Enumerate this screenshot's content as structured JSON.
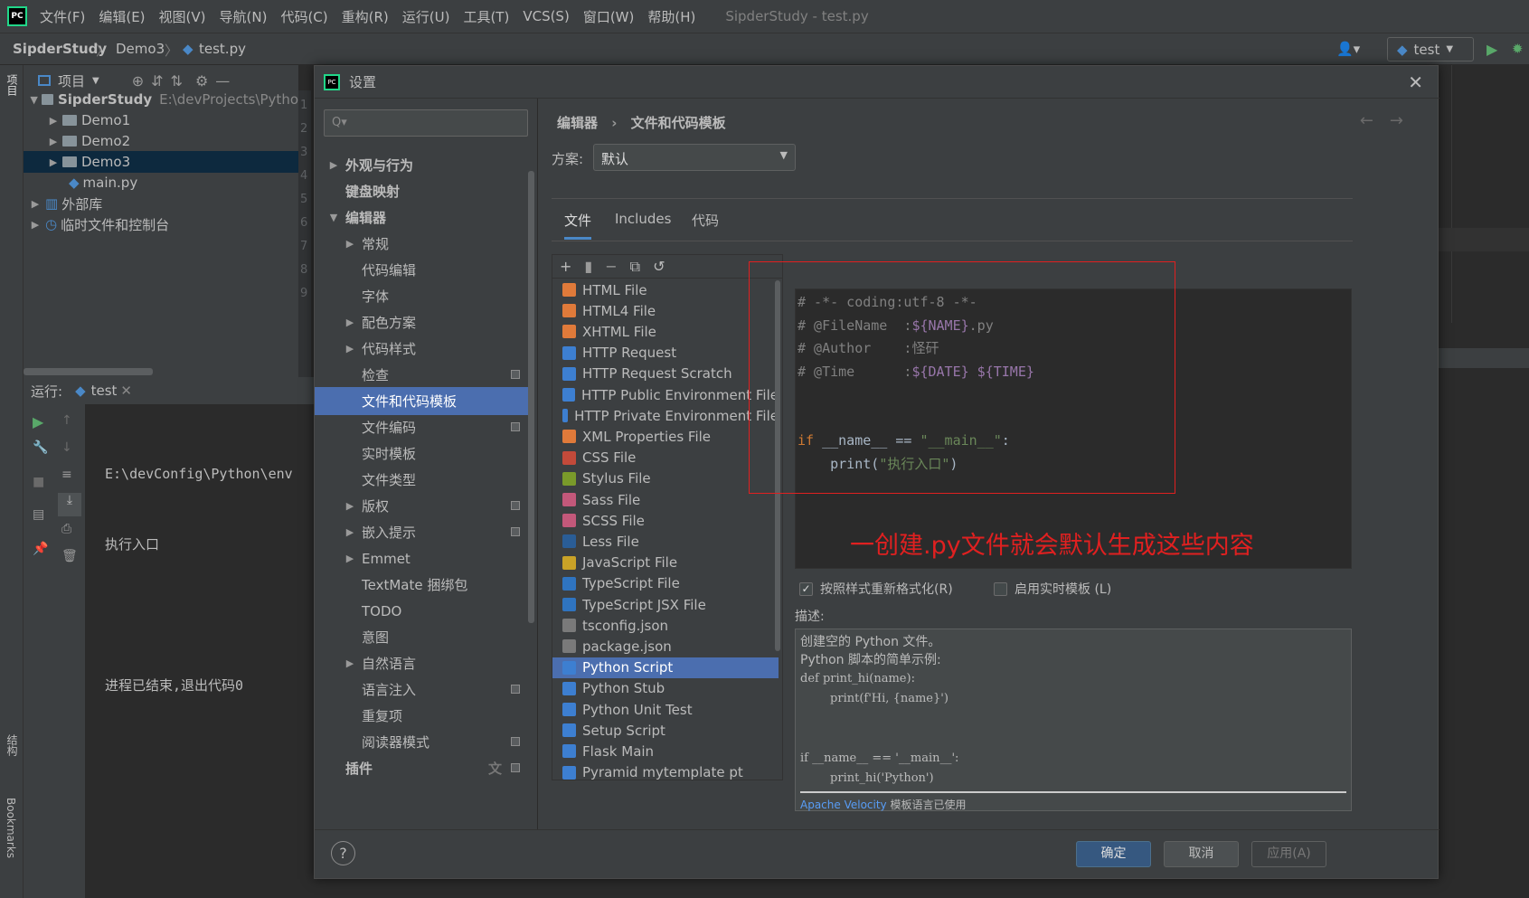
{
  "menubar": {
    "items": [
      "文件(F)",
      "编辑(E)",
      "视图(V)",
      "导航(N)",
      "代码(C)",
      "重构(R)",
      "运行(U)",
      "工具(T)",
      "VCS(S)",
      "窗口(W)",
      "帮助(H)"
    ],
    "window_title": "SipderStudy - test.py"
  },
  "navbar": {
    "project": "SipderStudy",
    "folder": "Demo3",
    "file": "test.py",
    "run_config": "test"
  },
  "left_strip": {
    "project_tab": "项目",
    "structure_tab": "结构",
    "bookmarks_tab": "Bookmarks"
  },
  "project_panel": {
    "title": "项目",
    "tree": [
      {
        "label": "SipderStudy",
        "path": "E:\\devProjects\\Pytho"
      },
      {
        "label": "Demo1"
      },
      {
        "label": "Demo2"
      },
      {
        "label": "Demo3"
      },
      {
        "label": "main.py"
      },
      {
        "label": "外部库"
      },
      {
        "label": "临时文件和控制台"
      }
    ]
  },
  "gutter_numbers": [
    "1",
    "2",
    "3",
    "4",
    "5",
    "6",
    "7",
    "8",
    "9"
  ],
  "run_panel": {
    "label": "运行:",
    "tab": "test",
    "output": [
      "E:\\devConfig\\Python\\env",
      "执行入口",
      "",
      "进程已结束,退出代码0"
    ]
  },
  "dialog": {
    "title": "设置",
    "search_placeholder": "Q▾",
    "sidebar": [
      "外观与行为",
      "键盘映射",
      "编辑器",
      "常规",
      "代码编辑",
      "字体",
      "配色方案",
      "代码样式",
      "检查",
      "文件和代码模板",
      "文件编码",
      "实时模板",
      "文件类型",
      "版权",
      "嵌入提示",
      "Emmet",
      "TextMate 捆绑包",
      "TODO",
      "意图",
      "自然语言",
      "语言注入",
      "重复项",
      "阅读器模式",
      "插件"
    ],
    "breadcrumb": [
      "编辑器",
      "文件和代码模板"
    ],
    "scheme_label": "方案:",
    "scheme_value": "默认",
    "tabs": [
      "文件",
      "Includes",
      "代码"
    ],
    "file_templates": [
      "HTML File",
      "HTML4 File",
      "XHTML File",
      "HTTP Request",
      "HTTP Request Scratch",
      "HTTP Public Environment File",
      "HTTP Private Environment File",
      "XML Properties File",
      "CSS File",
      "Stylus File",
      "Sass File",
      "SCSS File",
      "Less File",
      "JavaScript File",
      "TypeScript File",
      "TypeScript JSX File",
      "tsconfig.json",
      "package.json",
      "Python Script",
      "Python Stub",
      "Python Unit Test",
      "Setup Script",
      "Flask Main",
      "Pyramid mytemplate pt"
    ],
    "selected_template": "Python Script",
    "code_lines": {
      "l1": "# -*- coding:utf-8 -*-",
      "l2a": "# @FileName  :",
      "l2b": "${NAME}",
      "l2c": ".py",
      "l3a": "# @Author    :",
      "l3b": "怪矸",
      "l4a": "# @Time      :",
      "l4b": "${DATE} ${TIME}",
      "l5a": "if",
      "l5b": " __name__ == ",
      "l5c": "\"__main__\"",
      "l5d": ":",
      "l6a": "    print(",
      "l6b": "\"执行入口\"",
      "l6c": ")"
    },
    "annotation": "一创建.py文件就会默认生成这些内容",
    "reformat_label": "按照样式重新格式化(R)",
    "live_template_label": "启用实时模板 (L)",
    "description_label": "描述:",
    "description": {
      "line1": "创建空的 Python 文件。",
      "line2": "Python 脚本的简单示例:",
      "code": "def print_hi(name):\n        print(f'Hi, {name}')\n\n\nif __name__ == '__main__':\n        print_hi('Python')",
      "footer_link": "Apache Velocity",
      "footer_text": " 模板语言已使用"
    },
    "buttons": {
      "ok": "确定",
      "cancel": "取消",
      "apply": "应用(A)",
      "help": "?"
    }
  },
  "colors": {
    "accent": "#4b6eaf",
    "annotation_red": "#e02020",
    "bg": "#3c3f41"
  }
}
